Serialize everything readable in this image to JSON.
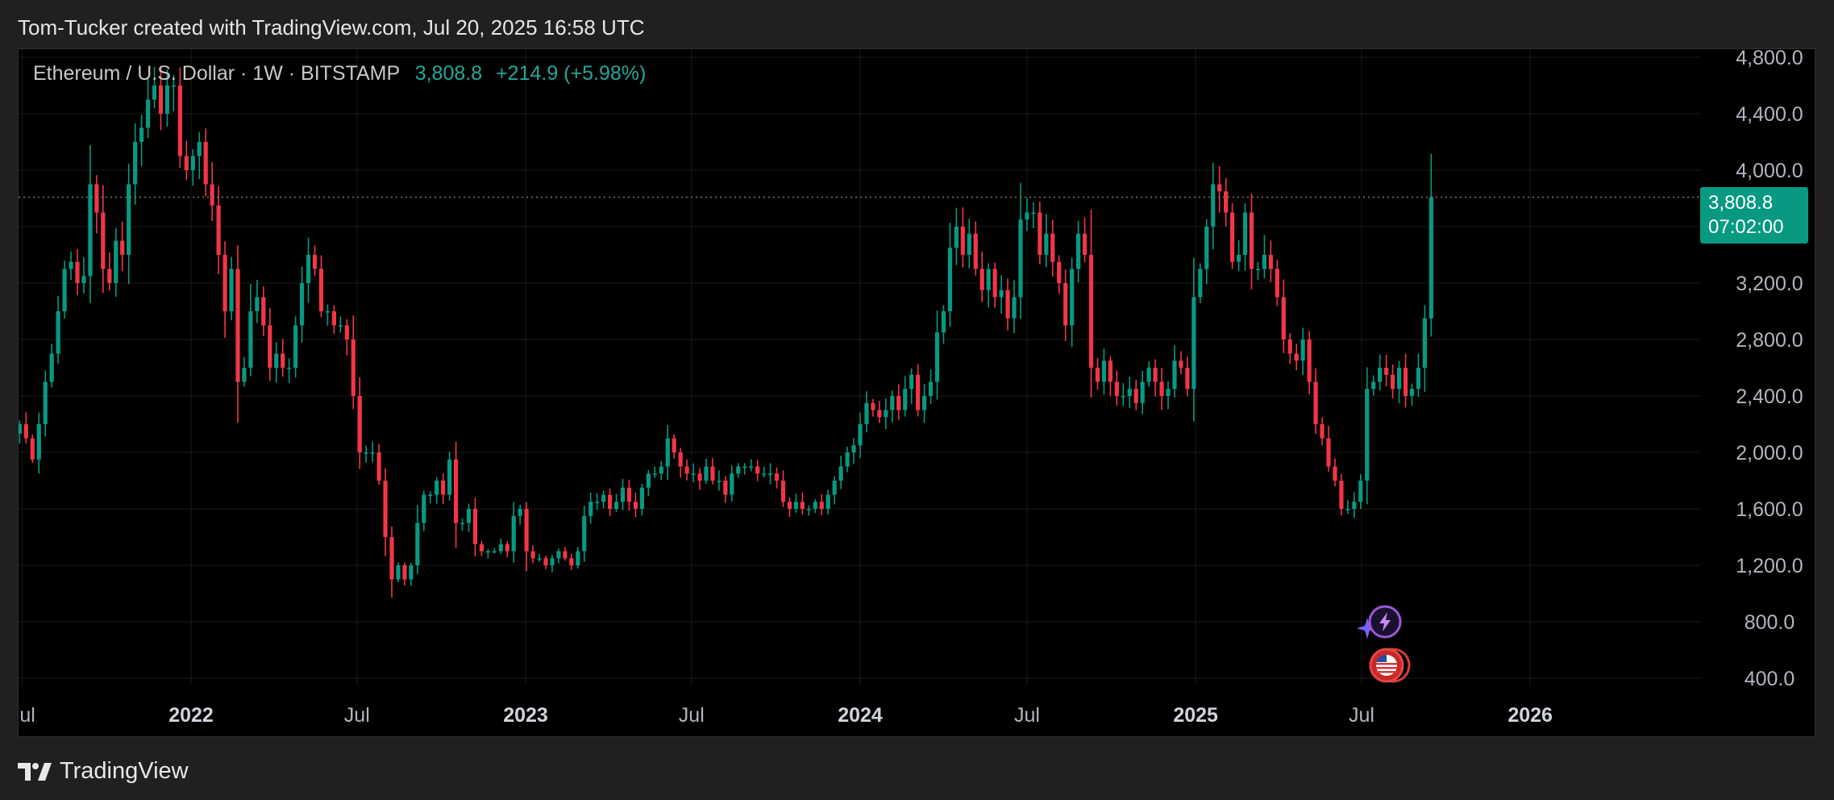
{
  "header": {
    "title": "Tom-Tucker created with TradingView.com, Jul 20, 2025 16:58 UTC"
  },
  "legend": {
    "symbol": "Ethereum / U.S. Dollar · 1W · BITSTAMP",
    "last": "3,808.8",
    "change": "+214.9 (+5.98%)"
  },
  "price_tag": {
    "price": "3,808.8",
    "countdown": "07:02:00"
  },
  "footer": {
    "brand": "TradingView"
  },
  "colors": {
    "up": "#089981",
    "down": "#f23645",
    "background": "#000000",
    "grid": "#1a1a1a"
  },
  "icons": [
    "lightning-event-icon",
    "sparkle-icon",
    "us-flag-event-icon",
    "tradingview-logo-icon"
  ],
  "chart_data": {
    "type": "candlestick",
    "interval": "1W",
    "y_axis": {
      "range": [
        400,
        4800
      ],
      "ticks": [
        "4,800.0",
        "4,400.0",
        "4,000.0",
        "3,600.0",
        "3,200.0",
        "2,800.0",
        "2,400.0",
        "2,000.0",
        "1,600.0",
        "1,200.0",
        "800.0",
        "400.0"
      ],
      "tick_values": [
        4800,
        4400,
        4000,
        3600,
        3200,
        2800,
        2400,
        2000,
        1600,
        1200,
        800,
        400
      ]
    },
    "x_axis": {
      "range": [
        "2021-06-28",
        "2026-12-31"
      ],
      "ticks": [
        {
          "label": "Jul",
          "date": "2021-07-01",
          "bold": false
        },
        {
          "label": "2022",
          "date": "2022-01-01",
          "bold": true
        },
        {
          "label": "Jul",
          "date": "2022-07-01",
          "bold": false
        },
        {
          "label": "2023",
          "date": "2023-01-01",
          "bold": true
        },
        {
          "label": "Jul",
          "date": "2023-07-01",
          "bold": false
        },
        {
          "label": "2024",
          "date": "2024-01-01",
          "bold": true
        },
        {
          "label": "Jul",
          "date": "2024-07-01",
          "bold": false
        },
        {
          "label": "2025",
          "date": "2025-01-01",
          "bold": true
        },
        {
          "label": "Jul",
          "date": "2025-07-01",
          "bold": false
        },
        {
          "label": "2026",
          "date": "2026-01-01",
          "bold": true
        }
      ]
    },
    "last_price": 3808.8,
    "grid": true,
    "start_week": "2021-06-28",
    "closes": [
      2200,
      2100,
      1950,
      2200,
      2500,
      2700,
      3000,
      3300,
      3350,
      3200,
      3250,
      3900,
      3700,
      3300,
      3200,
      3500,
      3400,
      3900,
      4200,
      4300,
      4500,
      4600,
      4400,
      4600,
      4600,
      4100,
      4000,
      4100,
      4200,
      3900,
      3750,
      3400,
      3000,
      3300,
      2500,
      2600,
      3000,
      3100,
      2900,
      2600,
      2700,
      2600,
      2600,
      2900,
      3200,
      3400,
      3300,
      3000,
      3000,
      2900,
      2900,
      2800,
      2400,
      2000,
      2000,
      2000,
      1800,
      1400,
      1100,
      1200,
      1100,
      1200,
      1500,
      1700,
      1700,
      1800,
      1700,
      1950,
      1500,
      1500,
      1600,
      1350,
      1300,
      1300,
      1300,
      1350,
      1300,
      1550,
      1600,
      1300,
      1250,
      1250,
      1200,
      1250,
      1300,
      1250,
      1200,
      1300,
      1550,
      1650,
      1650,
      1700,
      1600,
      1650,
      1750,
      1650,
      1600,
      1750,
      1850,
      1850,
      1900,
      2100,
      2000,
      1900,
      1850,
      1850,
      1800,
      1900,
      1800,
      1800,
      1700,
      1850,
      1900,
      1900,
      1900,
      1850,
      1850,
      1850,
      1800,
      1650,
      1600,
      1650,
      1600,
      1600,
      1650,
      1600,
      1700,
      1800,
      1900,
      2000,
      2050,
      2200,
      2350,
      2300,
      2250,
      2300,
      2400,
      2300,
      2450,
      2550,
      2300,
      2400,
      2500,
      2850,
      3000,
      3450,
      3600,
      3400,
      3550,
      3300,
      3150,
      3300,
      3100,
      3150,
      2950,
      3100,
      3650,
      3700,
      3700,
      3400,
      3550,
      3350,
      3200,
      2900,
      3300,
      3550,
      3400,
      2600,
      2500,
      2650,
      2500,
      2400,
      2400,
      2450,
      2350,
      2500,
      2600,
      2500,
      2400,
      2450,
      2650,
      2600,
      2450,
      3100,
      3300,
      3600,
      3900,
      3850,
      3700,
      3350,
      3400,
      3700,
      3300,
      3300,
      3400,
      3300,
      3100,
      2800,
      2700,
      2650,
      2800,
      2500,
      2200,
      2100,
      1900,
      1800,
      1600,
      1600,
      1650,
      1800,
      2450,
      2500,
      2600,
      2550,
      2450,
      2600,
      2400,
      2450,
      2600,
      2950,
      3808.8
    ]
  }
}
